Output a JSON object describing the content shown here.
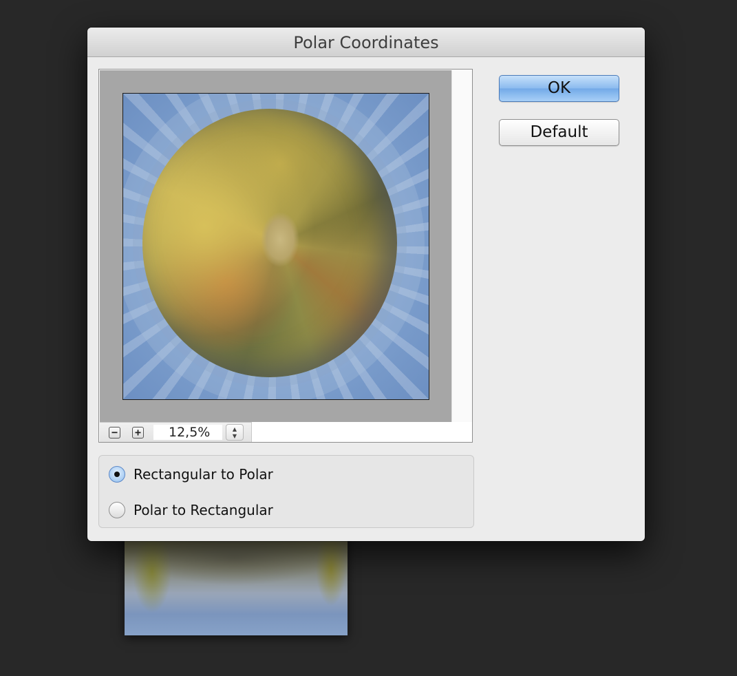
{
  "dialog": {
    "title": "Polar Coordinates"
  },
  "buttons": {
    "ok_label": "OK",
    "default_label": "Default"
  },
  "preview": {
    "zoom_out_icon": "minus-square-icon",
    "zoom_in_icon": "plus-square-icon",
    "zoom_out_symbol": "−",
    "zoom_in_symbol": "+",
    "zoom_value": "12,5%",
    "stepper_symbol": "▲\n▼"
  },
  "options": {
    "selected": "rectangular_to_polar",
    "items": [
      {
        "label": "Rectangular to Polar",
        "checked": true
      },
      {
        "label": "Polar to Rectangular",
        "checked": false
      }
    ]
  },
  "colors": {
    "window_bg": "#282828",
    "dialog_bg": "#ececec",
    "primary_button": "#8dbcef"
  }
}
